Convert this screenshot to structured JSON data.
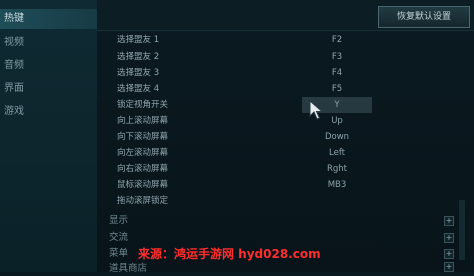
{
  "sidebar": {
    "items": [
      {
        "label": "热键",
        "active": true
      },
      {
        "label": "视频"
      },
      {
        "label": "音频"
      },
      {
        "label": "界面"
      },
      {
        "label": "游戏"
      }
    ]
  },
  "header": {
    "reset_label": "恢复默认设置"
  },
  "bindings": [
    {
      "label": "选择盟友 1",
      "key": "F2"
    },
    {
      "label": "选择盟友 2",
      "key": "F3"
    },
    {
      "label": "选择盟友 3",
      "key": "F4"
    },
    {
      "label": "选择盟友 4",
      "key": "F5"
    },
    {
      "label": "锁定视角开关",
      "key": "Y"
    },
    {
      "label": "向上滚动屏幕",
      "key": "Up"
    },
    {
      "label": "向下滚动屏幕",
      "key": "Down"
    },
    {
      "label": "向左滚动屏幕",
      "key": "Left"
    },
    {
      "label": "向右滚动屏幕",
      "key": "Rght"
    },
    {
      "label": "鼠标滚动屏幕",
      "key": "MB3"
    },
    {
      "label": "拖动滚屏锁定",
      "key": ""
    }
  ],
  "sections": [
    {
      "label": "显示"
    },
    {
      "label": "交流"
    },
    {
      "label": "菜单"
    },
    {
      "label": "道具商店"
    }
  ],
  "watermark": "来源：鸿运手游网 hyd028.com",
  "icons": {
    "cursor": "mouse-cursor-icon",
    "expand": "plus-icon"
  },
  "colors": {
    "background": "#0a1820",
    "sidebar_active": "#1f4d58",
    "watermark": "#ff2e2e"
  }
}
